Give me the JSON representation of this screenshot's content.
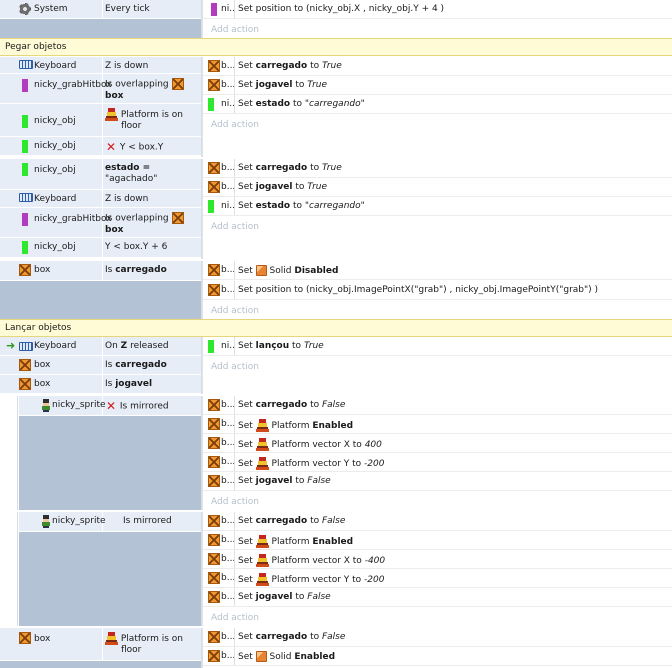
{
  "system_event": {
    "object": "System",
    "condition": "Every tick",
    "action_obj": "ni...",
    "action": "Set position to (nicky_obj.X , nicky_obj.Y + 4  )"
  },
  "add_action": "Add action",
  "group1": {
    "title": "Pegar objetos"
  },
  "ev1": {
    "c1_obj": "Keyboard",
    "c1": "Z is down",
    "c2_obj": "nicky_grabHitbox",
    "c2a": "Is overlapping",
    "c2b": "box",
    "c3_obj": "nicky_obj",
    "c3": "Platform is on floor",
    "c4_obj": "nicky_obj",
    "c4": "Y < box.Y",
    "a1_obj": "b...",
    "a1_pre": "Set",
    "a1_var": "carregado",
    "a1_to": "to",
    "a1_val": "True",
    "a2_obj": "b...",
    "a2_pre": "Set",
    "a2_var": "jogavel",
    "a2_to": "to",
    "a2_val": "True",
    "a3_obj": "ni...",
    "a3_pre": "Set",
    "a3_var": "estado",
    "a3_to": "to",
    "a3_val": "\"carregando\""
  },
  "ev2": {
    "c1_obj": "nicky_obj",
    "c1a": "estado =",
    "c1b": "\"agachado\"",
    "c2_obj": "Keyboard",
    "c2": "Z is down",
    "c3_obj": "nicky_grabHitbox",
    "c3a": "Is overlapping",
    "c3b": "box",
    "c4_obj": "nicky_obj",
    "c4": "Y < box.Y + 6",
    "a1_obj": "b...",
    "a1_pre": "Set",
    "a1_var": "carregado",
    "a1_to": "to",
    "a1_val": "True",
    "a2_obj": "b...",
    "a2_pre": "Set",
    "a2_var": "jogavel",
    "a2_to": "to",
    "a2_val": "True",
    "a3_obj": "ni...",
    "a3_pre": "Set",
    "a3_var": "estado",
    "a3_to": "to",
    "a3_val": "\"carregando\""
  },
  "ev3": {
    "c1_obj": "box",
    "c1_pre": "Is",
    "c1_var": "carregado",
    "a1_obj": "b...",
    "a1_pre": "Set",
    "a1_b": "Solid",
    "a1_val": "Disabled",
    "a2_obj": "b...",
    "a2": "Set position to (nicky_obj.ImagePointX(\"grab\") , nicky_obj.ImagePointY(\"grab\") )"
  },
  "group2": {
    "title": "Lançar objetos"
  },
  "ev4": {
    "c1_obj": "Keyboard",
    "c1_pre": "On",
    "c1_key": "Z",
    "c1_post": "released",
    "c2_obj": "box",
    "c2_pre": "Is",
    "c2_var": "carregado",
    "c3_obj": "box",
    "c3_pre": "Is",
    "c3_var": "jogavel",
    "a1_obj": "ni...",
    "a1_pre": "Set",
    "a1_var": "lançou",
    "a1_to": "to",
    "a1_val": "True"
  },
  "sub1": {
    "c1_obj": "nicky_sprite",
    "c1": "Is mirrored",
    "a1_obj": "b...",
    "a1_pre": "Set",
    "a1_var": "carregado",
    "a1_to": "to",
    "a1_val": "False",
    "a2_obj": "b...",
    "a2_pre": "Set",
    "a2_b": "Platform",
    "a2_val": "Enabled",
    "a3_obj": "b...",
    "a3_pre": "Set",
    "a3_b": "Platform vector X to",
    "a3_val": "400",
    "a4_obj": "b...",
    "a4_pre": "Set",
    "a4_b": "Platform vector Y to",
    "a4_val": "-200",
    "a5_obj": "b...",
    "a5_pre": "Set",
    "a5_var": "jogavel",
    "a5_to": "to",
    "a5_val": "False"
  },
  "sub2": {
    "c1_obj": "nicky_sprite",
    "c1": "Is mirrored",
    "a1_obj": "b...",
    "a1_pre": "Set",
    "a1_var": "carregado",
    "a1_to": "to",
    "a1_val": "False",
    "a2_obj": "b...",
    "a2_pre": "Set",
    "a2_b": "Platform",
    "a2_val": "Enabled",
    "a3_obj": "b...",
    "a3_pre": "Set",
    "a3_b": "Platform vector X to",
    "a3_val": "-400",
    "a4_obj": "b...",
    "a4_pre": "Set",
    "a4_b": "Platform vector Y to",
    "a4_val": "-200",
    "a5_obj": "b...",
    "a5_pre": "Set",
    "a5_var": "jogavel",
    "a5_to": "to",
    "a5_val": "False"
  },
  "ev5": {
    "c1_obj": "box",
    "c1": "Platform is on floor",
    "a1_obj": "b...",
    "a1_pre": "Set",
    "a1_var": "carregado",
    "a1_to": "to",
    "a1_val": "False",
    "a2_obj": "b...",
    "a2_pre": "Set",
    "a2_b": "Solid",
    "a2_val": "Enabled"
  }
}
